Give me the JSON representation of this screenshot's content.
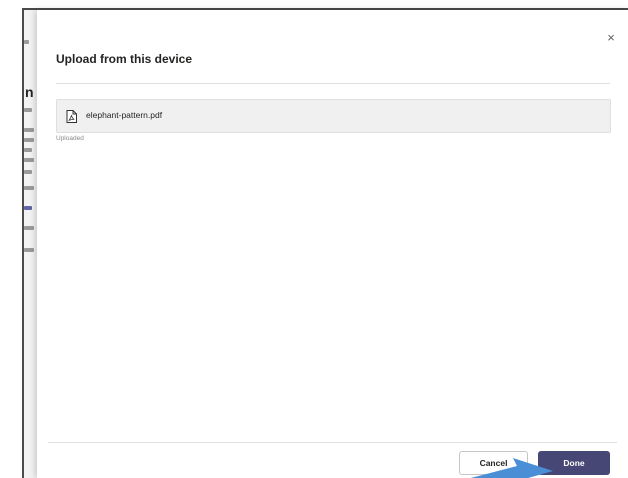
{
  "dialog": {
    "title": "Upload from this device",
    "close_glyph": "×",
    "close_icon": "close-icon"
  },
  "file": {
    "name": "elephant-pattern.pdf",
    "icon": "pdf-file-icon",
    "status": "Uploaded"
  },
  "footer": {
    "cancel_label": "Cancel",
    "done_label": "Done"
  },
  "background": {
    "fragment": "n"
  },
  "colors": {
    "primary": "#464775",
    "overlay": "#4b4b4b",
    "pointer": "#4a8fd6"
  }
}
